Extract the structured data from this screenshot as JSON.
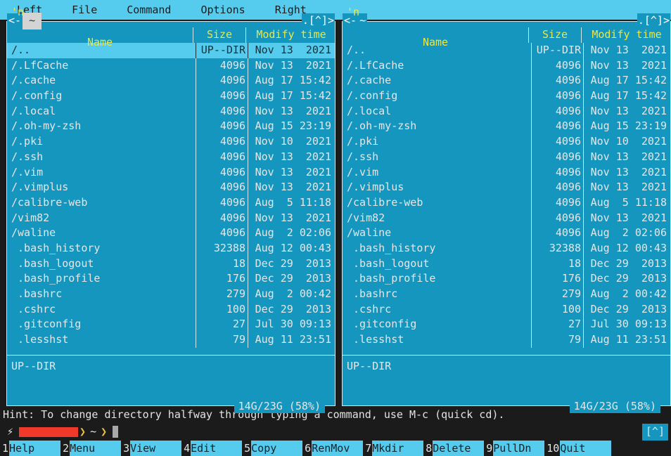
{
  "menu": {
    "items": [
      "Left",
      "File",
      "Command",
      "Options",
      "Right"
    ]
  },
  "panels": {
    "left": {
      "path": "~",
      "left_arrow": "<-",
      "corner": ".[^]>",
      "active": true,
      "columns": {
        "sort_indicator": "'n",
        "name": "Name",
        "size": "Size",
        "time": "Modify time"
      },
      "mini_status": "UP--DIR",
      "free_space": "14G/23G (58%)",
      "rows": [
        {
          "name": "/..",
          "size": "UP--DIR",
          "time": "Nov 13  2021",
          "selected": true
        },
        {
          "name": "/.LfCache",
          "size": "4096",
          "time": "Nov 13  2021",
          "selected": false
        },
        {
          "name": "/.cache",
          "size": "4096",
          "time": "Aug 17 15:42",
          "selected": false
        },
        {
          "name": "/.config",
          "size": "4096",
          "time": "Aug 17 15:42",
          "selected": false
        },
        {
          "name": "/.local",
          "size": "4096",
          "time": "Nov 13  2021",
          "selected": false
        },
        {
          "name": "/.oh-my-zsh",
          "size": "4096",
          "time": "Aug 15 23:19",
          "selected": false
        },
        {
          "name": "/.pki",
          "size": "4096",
          "time": "Nov 10  2021",
          "selected": false
        },
        {
          "name": "/.ssh",
          "size": "4096",
          "time": "Nov 13  2021",
          "selected": false
        },
        {
          "name": "/.vim",
          "size": "4096",
          "time": "Nov 13  2021",
          "selected": false
        },
        {
          "name": "/.vimplus",
          "size": "4096",
          "time": "Nov 13  2021",
          "selected": false
        },
        {
          "name": "/calibre-web",
          "size": "4096",
          "time": "Aug  5 11:18",
          "selected": false
        },
        {
          "name": "/vim82",
          "size": "4096",
          "time": "Nov 13  2021",
          "selected": false
        },
        {
          "name": "/waline",
          "size": "4096",
          "time": "Aug  2 02:06",
          "selected": false
        },
        {
          "name": " .bash_history",
          "size": "32388",
          "time": "Aug 12 00:43",
          "selected": false
        },
        {
          "name": " .bash_logout",
          "size": "18",
          "time": "Dec 29  2013",
          "selected": false
        },
        {
          "name": " .bash_profile",
          "size": "176",
          "time": "Dec 29  2013",
          "selected": false
        },
        {
          "name": " .bashrc",
          "size": "279",
          "time": "Aug  2 00:42",
          "selected": false
        },
        {
          "name": " .cshrc",
          "size": "100",
          "time": "Dec 29  2013",
          "selected": false
        },
        {
          "name": " .gitconfig",
          "size": "27",
          "time": "Jul 30 09:13",
          "selected": false
        },
        {
          "name": " .lesshst",
          "size": "79",
          "time": "Aug 11 23:51",
          "selected": false
        }
      ]
    },
    "right": {
      "path": "~",
      "left_arrow": "<-",
      "corner": ".[^]>",
      "active": false,
      "columns": {
        "sort_indicator": "'n",
        "name": "Name",
        "size": "Size",
        "time": "Modify time"
      },
      "mini_status": "UP--DIR",
      "free_space": "14G/23G (58%)",
      "rows": [
        {
          "name": "/..",
          "size": "UP--DIR",
          "time": "Nov 13  2021",
          "selected": false
        },
        {
          "name": "/.LfCache",
          "size": "4096",
          "time": "Nov 13  2021",
          "selected": false
        },
        {
          "name": "/.cache",
          "size": "4096",
          "time": "Aug 17 15:42",
          "selected": false
        },
        {
          "name": "/.config",
          "size": "4096",
          "time": "Aug 17 15:42",
          "selected": false
        },
        {
          "name": "/.local",
          "size": "4096",
          "time": "Nov 13  2021",
          "selected": false
        },
        {
          "name": "/.oh-my-zsh",
          "size": "4096",
          "time": "Aug 15 23:19",
          "selected": false
        },
        {
          "name": "/.pki",
          "size": "4096",
          "time": "Nov 10  2021",
          "selected": false
        },
        {
          "name": "/.ssh",
          "size": "4096",
          "time": "Nov 13  2021",
          "selected": false
        },
        {
          "name": "/.vim",
          "size": "4096",
          "time": "Nov 13  2021",
          "selected": false
        },
        {
          "name": "/.vimplus",
          "size": "4096",
          "time": "Nov 13  2021",
          "selected": false
        },
        {
          "name": "/calibre-web",
          "size": "4096",
          "time": "Aug  5 11:18",
          "selected": false
        },
        {
          "name": "/vim82",
          "size": "4096",
          "time": "Nov 13  2021",
          "selected": false
        },
        {
          "name": "/waline",
          "size": "4096",
          "time": "Aug  2 02:06",
          "selected": false
        },
        {
          "name": " .bash_history",
          "size": "32388",
          "time": "Aug 12 00:43",
          "selected": false
        },
        {
          "name": " .bash_logout",
          "size": "18",
          "time": "Dec 29  2013",
          "selected": false
        },
        {
          "name": " .bash_profile",
          "size": "176",
          "time": "Dec 29  2013",
          "selected": false
        },
        {
          "name": " .bashrc",
          "size": "279",
          "time": "Aug  2 00:42",
          "selected": false
        },
        {
          "name": " .cshrc",
          "size": "100",
          "time": "Dec 29  2013",
          "selected": false
        },
        {
          "name": " .gitconfig",
          "size": "27",
          "time": "Jul 30 09:13",
          "selected": false
        },
        {
          "name": " .lesshst",
          "size": "79",
          "time": "Aug 11 23:51",
          "selected": false
        }
      ]
    }
  },
  "hint": "Hint: To change directory halfway through typing a command, use M-c (quick cd).",
  "prompt": {
    "bolt_icon": "⚡",
    "redacted": "",
    "separator_icon": "❯",
    "cwd": "~",
    "cursor": "",
    "corner_button": "[^]"
  },
  "fkeys": [
    {
      "num": "1",
      "label": "Help"
    },
    {
      "num": "2",
      "label": "Menu"
    },
    {
      "num": "3",
      "label": "View"
    },
    {
      "num": "4",
      "label": "Edit"
    },
    {
      "num": "5",
      "label": "Copy"
    },
    {
      "num": "6",
      "label": "RenMov"
    },
    {
      "num": "7",
      "label": "Mkdir"
    },
    {
      "num": "8",
      "label": "Delete"
    },
    {
      "num": "9",
      "label": "PullDn"
    },
    {
      "num": "10",
      "label": "Quit"
    }
  ],
  "colors": {
    "menu_bg": "#55ccee",
    "panel_bg": "#1496bf",
    "selection_bg": "#55ccee",
    "header_fg": "#e8e84a",
    "screen_bg": "#1b1b1b",
    "redact_red": "#f0392b",
    "powerline_arrow": "#f0c040"
  }
}
